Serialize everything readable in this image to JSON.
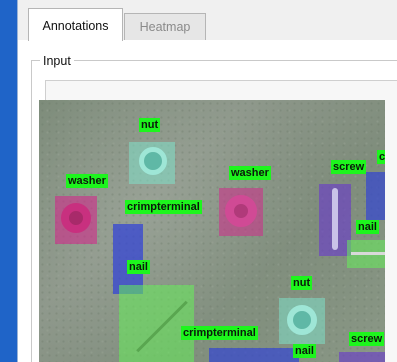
{
  "tabs": [
    {
      "label": "Annotations",
      "active": true
    },
    {
      "label": "Heatmap",
      "active": false
    }
  ],
  "group": {
    "title": "Input"
  },
  "detections": [
    {
      "label": "nut"
    },
    {
      "label": "washer"
    },
    {
      "label": "washer"
    },
    {
      "label": "crimpterminal"
    },
    {
      "label": "screw"
    },
    {
      "label": "cri"
    },
    {
      "label": "nail"
    },
    {
      "label": "nail"
    },
    {
      "label": "nut"
    },
    {
      "label": "crimpterminal"
    },
    {
      "label": "nail"
    },
    {
      "label": "screw"
    }
  ],
  "colors": {
    "label_bg": "#1df51d",
    "nut_box": "#7fe0c8",
    "washer_box": "#d02a8a",
    "nail_box": "#2d3fd8",
    "screw_box": "#6a3dc8",
    "crimpterminal_box": "#66f05a"
  }
}
